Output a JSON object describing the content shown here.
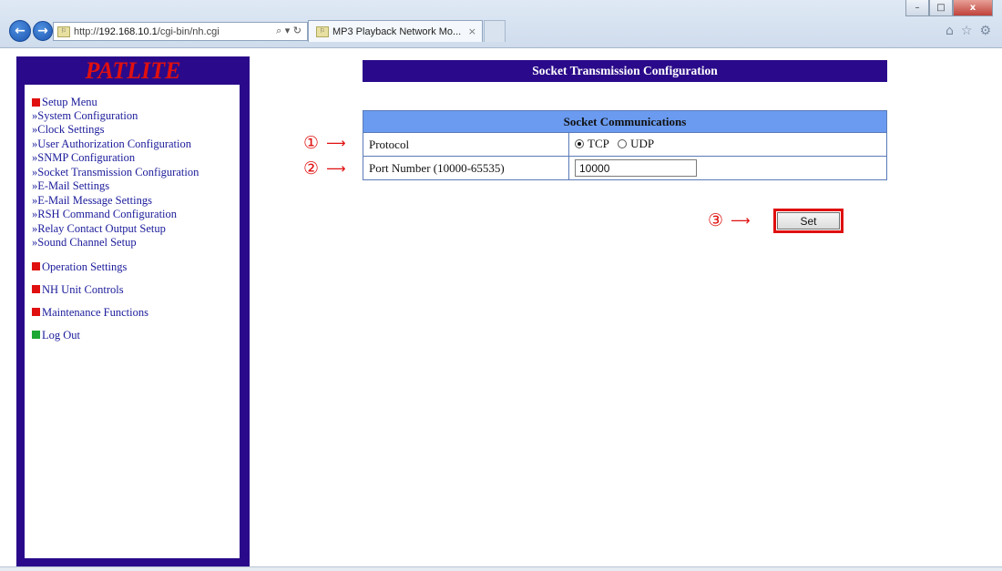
{
  "browser": {
    "url_prefix": "http://",
    "url_host": "192.168.10.1",
    "url_path": "/cgi-bin/nh.cgi",
    "address_tools": "⌕ ▾ ↻",
    "tab_title": "MP3 Playback Network Mo...",
    "tab_close": "×",
    "win_minimize": "–",
    "win_maximize": "□",
    "win_close": "x",
    "fav_label": "⚐"
  },
  "sidebar": {
    "logo": "PATLITE",
    "setup_menu": {
      "title": "Setup Menu",
      "items": [
        "»System Configuration",
        "»Clock Settings",
        "»User Authorization Configuration",
        "»SNMP Configuration",
        "»Socket Transmission Configuration",
        "»E-Mail Settings",
        "»E-Mail Message Settings",
        "»RSH Command Configuration",
        "»Relay Contact Output Setup",
        "»Sound Channel Setup"
      ]
    },
    "sections": [
      "Operation Settings",
      "NH Unit Controls",
      "Maintenance Functions"
    ],
    "logout": "Log Out"
  },
  "main": {
    "page_title": "Socket Transmission Configuration",
    "table": {
      "header": "Socket Communications",
      "protocol_label": "Protocol",
      "protocol_options": [
        "TCP",
        "UDP"
      ],
      "protocol_selected": "TCP",
      "port_label": "Port Number (10000-65535)",
      "port_value": "10000"
    },
    "set_button": "Set"
  },
  "annotations": {
    "one": "①",
    "two": "②",
    "three": "③",
    "arrow": "⟶"
  },
  "colors": {
    "sidebar_bg": "#2a0a8a",
    "logo": "#e01010",
    "table_header": "#6a9bf0",
    "annotation": "#e01010",
    "logout_marker": "#1aa832"
  }
}
